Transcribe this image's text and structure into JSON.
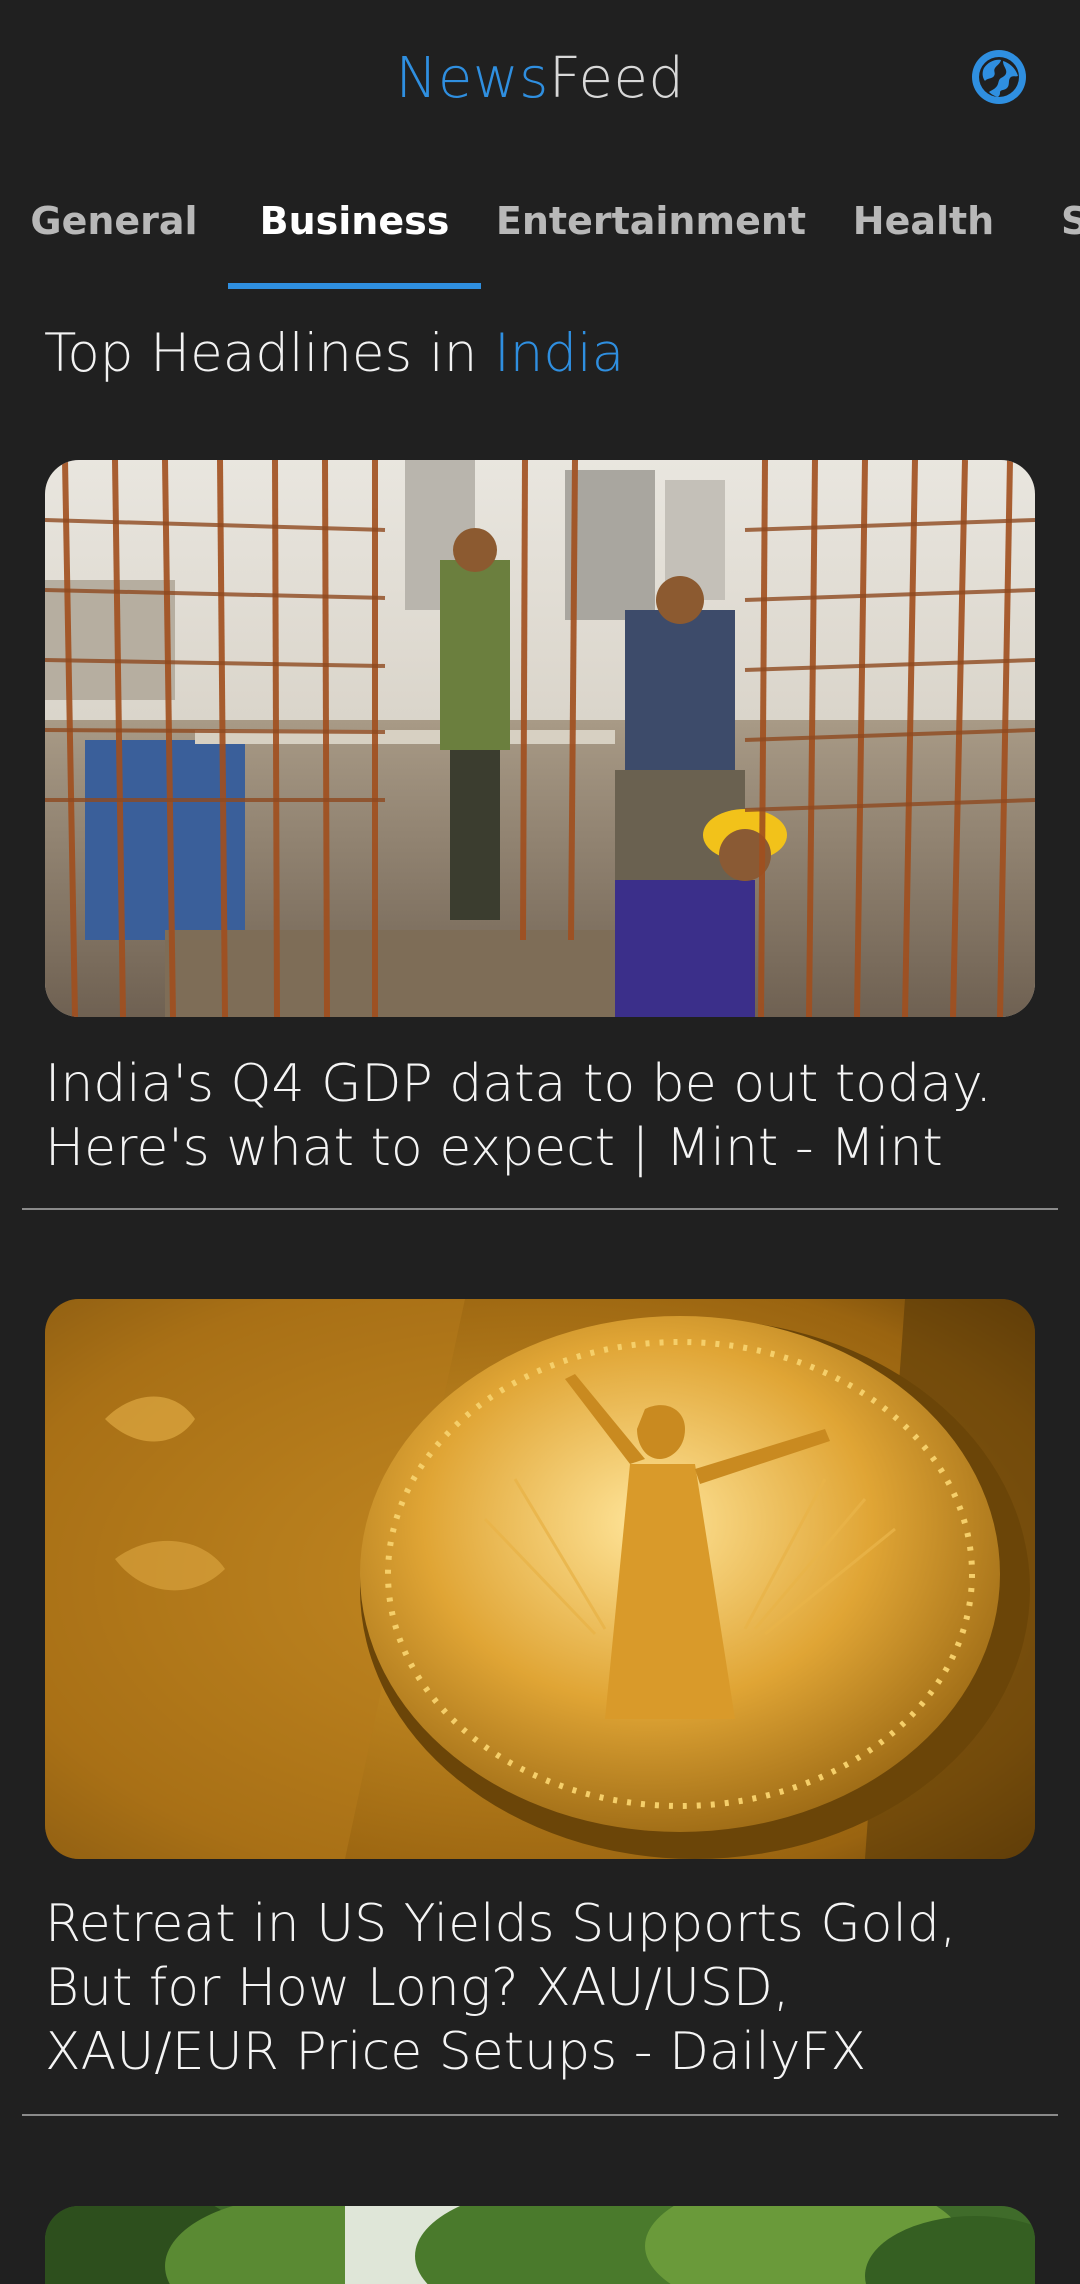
{
  "app": {
    "title_part1": "News",
    "title_part2": "Feed",
    "accent_color": "#2f8fe0",
    "background_color": "#202020",
    "region_icon": "globe-icon"
  },
  "tabs": [
    {
      "label": "General",
      "active": false
    },
    {
      "label": "Business",
      "active": true
    },
    {
      "label": "Entertainment",
      "active": false
    },
    {
      "label": "Health",
      "active": false
    },
    {
      "label": "S",
      "active": false
    }
  ],
  "section": {
    "prefix": "Top Headlines in",
    "country": "India"
  },
  "articles": [
    {
      "title": "India's Q4 GDP data to be out today. Here's what to expect | Mint - Mint",
      "image": "construction-workers-photo"
    },
    {
      "title": "Retreat in US Yields Supports Gold, But for How Long? XAU/USD, XAU/EUR Price Setups - DailyFX",
      "image": "gold-coin-photo"
    },
    {
      "title": "",
      "image": "trees-photo"
    }
  ]
}
